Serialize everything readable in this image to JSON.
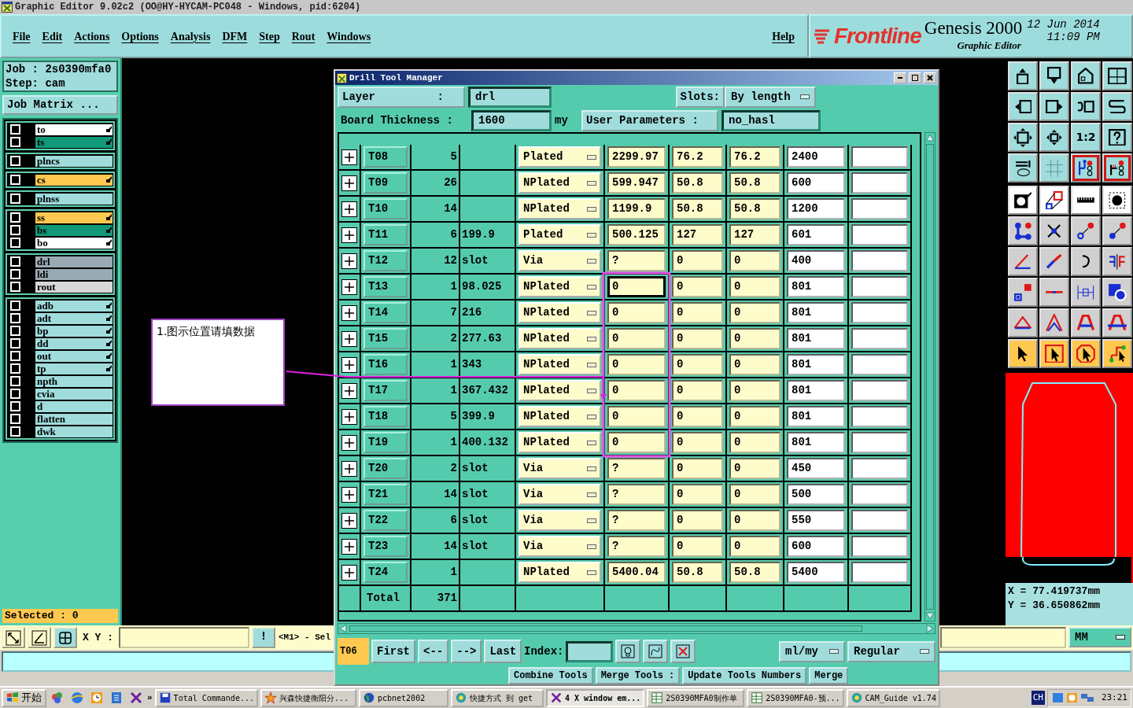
{
  "window": {
    "title": "Graphic Editor 9.02c2 (OO@HY-HYCAM-PC048 - Windows, pid:6204)"
  },
  "menu": [
    "File",
    "Edit",
    "Actions",
    "Options",
    "Analysis",
    "DFM",
    "Step",
    "Rout",
    "Windows"
  ],
  "help": "Help",
  "branding": {
    "logo": "Frontline",
    "product": "Genesis 2000",
    "subtitle": "Graphic Editor",
    "date": "12 Jun 2014",
    "time": "11:09 PM"
  },
  "job": {
    "job": "Job : 2s0390mfa0",
    "step": "Step: cam",
    "matrix_button": "Job Matrix ..."
  },
  "layer_groups": [
    [
      {
        "name": "to",
        "color": "#ffffff",
        "marked": true,
        "checked": false
      },
      {
        "name": "ts",
        "color": "#11997a",
        "marked": true,
        "checked": false
      }
    ],
    [
      {
        "name": "plncs",
        "color": "#a0dcdc",
        "marked": false,
        "checked": false
      }
    ],
    [
      {
        "name": "cs",
        "color": "#ffc850",
        "marked": true,
        "checked": false
      }
    ],
    [
      {
        "name": "plnss",
        "color": "#a0dcdc",
        "marked": false,
        "checked": false
      }
    ],
    [
      {
        "name": "ss",
        "color": "#ffc850",
        "marked": true,
        "checked": false
      },
      {
        "name": "bs",
        "color": "#11997a",
        "marked": true,
        "checked": false
      },
      {
        "name": "bo",
        "color": "#ffffff",
        "marked": true,
        "checked": false
      }
    ],
    [
      {
        "name": "drl",
        "color": "#9aaab4",
        "marked": false,
        "checked": false
      },
      {
        "name": "ldi",
        "color": "#9aaab4",
        "marked": false,
        "checked": false
      },
      {
        "name": "rout",
        "color": "#d8d8d8",
        "marked": false,
        "checked": false
      }
    ],
    [
      {
        "name": "adb",
        "color": "#a0dcdc",
        "marked": true,
        "checked": false
      },
      {
        "name": "adt",
        "color": "#a0dcdc",
        "marked": true,
        "checked": false
      },
      {
        "name": "bp",
        "color": "#a0dcdc",
        "marked": true,
        "checked": false
      },
      {
        "name": "dd",
        "color": "#a0dcdc",
        "marked": true,
        "checked": false
      },
      {
        "name": "out",
        "color": "#a0dcdc",
        "marked": true,
        "checked": false
      },
      {
        "name": "tp",
        "color": "#a0dcdc",
        "marked": true,
        "checked": false
      },
      {
        "name": "npth",
        "color": "#a0dcdc",
        "marked": false,
        "checked": false
      },
      {
        "name": "cvia",
        "color": "#a0dcdc",
        "marked": false,
        "checked": false
      },
      {
        "name": "d",
        "color": "#a0dcdc",
        "marked": false,
        "checked": false
      },
      {
        "name": "flatten",
        "color": "#a0dcdc",
        "marked": false,
        "checked": false
      },
      {
        "name": "dwk",
        "color": "#a0dcdc",
        "marked": false,
        "checked": false
      }
    ]
  ],
  "selected_count": "Selected : 0",
  "toolbar": {
    "ratio_label": "1:2",
    "layer_toggles": [
      {
        "on": true
      },
      {
        "on": true
      }
    ]
  },
  "coordinates": {
    "x": "X = 77.419737mm",
    "y": "Y = 36.650862mm"
  },
  "bottom_bar": {
    "xy_label": "X Y :",
    "alert_button": "!",
    "message": "<M1> - Sel",
    "units": "MM"
  },
  "dialog": {
    "title": "Drill Tool Manager",
    "layer_label": "Layer :",
    "layer": "drl",
    "slots_label": "Slots:",
    "slots": "By length",
    "thickness_label": "Board Thickness :",
    "thickness": "1600",
    "thickness_unit": "my",
    "user_params_label": "User Parameters :",
    "user_params": "no_hasl",
    "tools": [
      {
        "name": "T08",
        "count": "5",
        "type": "Plated",
        "finish": "2299.97",
        "min_tol": "76.2",
        "max_tol": "76.2",
        "drill": "2400",
        "focused": false
      },
      {
        "name": "T09",
        "count": "26",
        "type": "NPlated",
        "finish": "599.947",
        "min_tol": "50.8",
        "max_tol": "50.8",
        "drill": "600",
        "focused": false
      },
      {
        "name": "T10",
        "count": "14",
        "type": "NPlated",
        "finish": "1199.9",
        "min_tol": "50.8",
        "max_tol": "50.8",
        "drill": "1200",
        "focused": false
      },
      {
        "name": "T11",
        "count": "6",
        "size": "199.9",
        "type": "Plated",
        "finish": "500.125",
        "min_tol": "127",
        "max_tol": "127",
        "drill": "601",
        "focused": false
      },
      {
        "name": "T12",
        "count": "12",
        "size": "slot",
        "type": "Via",
        "finish": "?",
        "min_tol": "0",
        "max_tol": "0",
        "drill": "400",
        "focused": false
      },
      {
        "name": "T13",
        "count": "1",
        "size": "98.025",
        "type": "NPlated",
        "finish": "0",
        "min_tol": "0",
        "max_tol": "0",
        "drill": "801",
        "focused": true
      },
      {
        "name": "T14",
        "count": "7",
        "size": "216",
        "type": "NPlated",
        "finish": "0",
        "min_tol": "0",
        "max_tol": "0",
        "drill": "801",
        "focused": false
      },
      {
        "name": "T15",
        "count": "2",
        "size": "277.63",
        "type": "NPlated",
        "finish": "0",
        "min_tol": "0",
        "max_tol": "0",
        "drill": "801",
        "focused": false
      },
      {
        "name": "T16",
        "count": "1",
        "size": "343",
        "type": "NPlated",
        "finish": "0",
        "min_tol": "0",
        "max_tol": "0",
        "drill": "801",
        "focused": false
      },
      {
        "name": "T17",
        "count": "1",
        "size": "367.432",
        "type": "NPlated",
        "finish": "0",
        "min_tol": "0",
        "max_tol": "0",
        "drill": "801",
        "focused": false
      },
      {
        "name": "T18",
        "count": "5",
        "size": "399.9",
        "type": "NPlated",
        "finish": "0",
        "min_tol": "0",
        "max_tol": "0",
        "drill": "801",
        "focused": false
      },
      {
        "name": "T19",
        "count": "1",
        "size": "400.132",
        "type": "NPlated",
        "finish": "0",
        "min_tol": "0",
        "max_tol": "0",
        "drill": "801",
        "focused": false
      },
      {
        "name": "T20",
        "count": "2",
        "size": "slot",
        "type": "Via",
        "finish": "?",
        "min_tol": "0",
        "max_tol": "0",
        "drill": "450",
        "focused": false
      },
      {
        "name": "T21",
        "count": "14",
        "size": "slot",
        "type": "Via",
        "finish": "?",
        "min_tol": "0",
        "max_tol": "0",
        "drill": "500",
        "focused": false
      },
      {
        "name": "T22",
        "count": "6",
        "size": "slot",
        "type": "Via",
        "finish": "?",
        "min_tol": "0",
        "max_tol": "0",
        "drill": "550",
        "focused": false
      },
      {
        "name": "T23",
        "count": "14",
        "size": "slot",
        "type": "Via",
        "finish": "?",
        "min_tol": "0",
        "max_tol": "0",
        "drill": "600",
        "focused": false
      },
      {
        "name": "T24",
        "count": "1",
        "type": "NPlated",
        "finish": "5400.04",
        "min_tol": "50.8",
        "max_tol": "50.8",
        "drill": "5400",
        "focused": false
      }
    ],
    "total_label": "Total",
    "total": "371",
    "current_tool": "T06",
    "nav": [
      "First",
      "<--",
      "-->",
      "Last"
    ],
    "index_label": "Index:",
    "units": "ml/my",
    "mode": "Regular",
    "actions": [
      "Combine Tools",
      "Merge Tools :",
      "Update Tools Numbers",
      "Merge"
    ]
  },
  "callout": {
    "text": "1.图示位置请填数据"
  },
  "taskbar": {
    "start": "开始",
    "more": "»",
    "tasks": [
      {
        "label": "Total Commande...",
        "selected": false
      },
      {
        "label": "兴森快捷衡阳分...",
        "selected": false
      },
      {
        "label": "pcbnet2002",
        "selected": false
      },
      {
        "label": "快捷方式 到 get",
        "selected": false
      },
      {
        "label": "4 X window em...",
        "selected": true
      },
      {
        "label": "2S0390MFA0制作单",
        "selected": false
      },
      {
        "label": "2S0390MFA0-预...",
        "selected": false
      },
      {
        "label": "CAM_Guide v1.74",
        "selected": false
      }
    ],
    "language": "CH",
    "clock": "23:21"
  }
}
